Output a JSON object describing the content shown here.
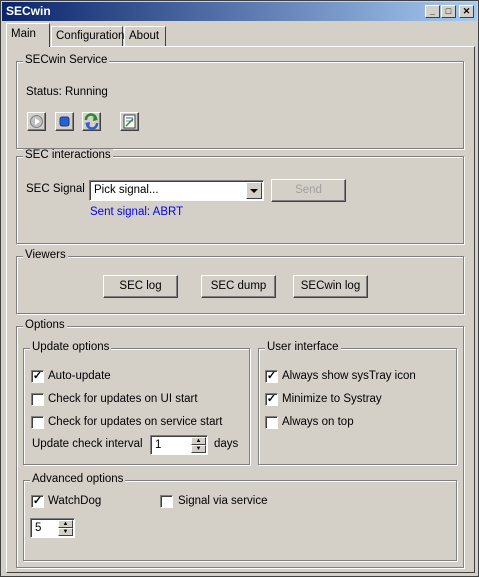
{
  "window": {
    "title": "SECwin",
    "minimize_label": "_",
    "maximize_label": "□",
    "close_label": "✕"
  },
  "tabs": [
    {
      "label": "Main",
      "active": true
    },
    {
      "label": "Configuration",
      "active": false
    },
    {
      "label": "About",
      "active": false
    }
  ],
  "service": {
    "group_title": "SECwin Service",
    "status_text": "Status: Running",
    "icons": [
      "play-icon",
      "stop-icon",
      "restart-icon",
      "properties-icon"
    ]
  },
  "interactions": {
    "group_title": "SEC interactions",
    "signal_label": "SEC Signal",
    "signal_select_value": "Pick signal...",
    "send_label": "Send",
    "sent_signal_text": "Sent signal: ABRT",
    "sent_signal_color": "#0000ff"
  },
  "viewers": {
    "group_title": "Viewers",
    "buttons": [
      "SEC log",
      "SEC dump",
      "SECwin log"
    ]
  },
  "options": {
    "group_title": "Options",
    "update": {
      "group_title": "Update options",
      "auto_update": {
        "label": "Auto-update",
        "checked": true
      },
      "check_ui_start": {
        "label": "Check for updates on UI start",
        "checked": false
      },
      "check_service_start": {
        "label": "Check for updates on service start",
        "checked": false
      },
      "interval_label": "Update check interval",
      "interval_value": "1",
      "interval_unit": "days"
    },
    "ui": {
      "group_title": "User interface",
      "systray_icon": {
        "label": "Always show sysTray icon",
        "checked": true
      },
      "minimize_systray": {
        "label": "Minimize to Systray",
        "checked": true
      },
      "always_on_top": {
        "label": "Always on top",
        "checked": false
      }
    },
    "advanced": {
      "group_title": "Advanced options",
      "watchdog": {
        "label": "WatchDog",
        "checked": true
      },
      "signal_via_service": {
        "label": "Signal via service",
        "checked": false
      },
      "watchdog_value": "5"
    }
  }
}
